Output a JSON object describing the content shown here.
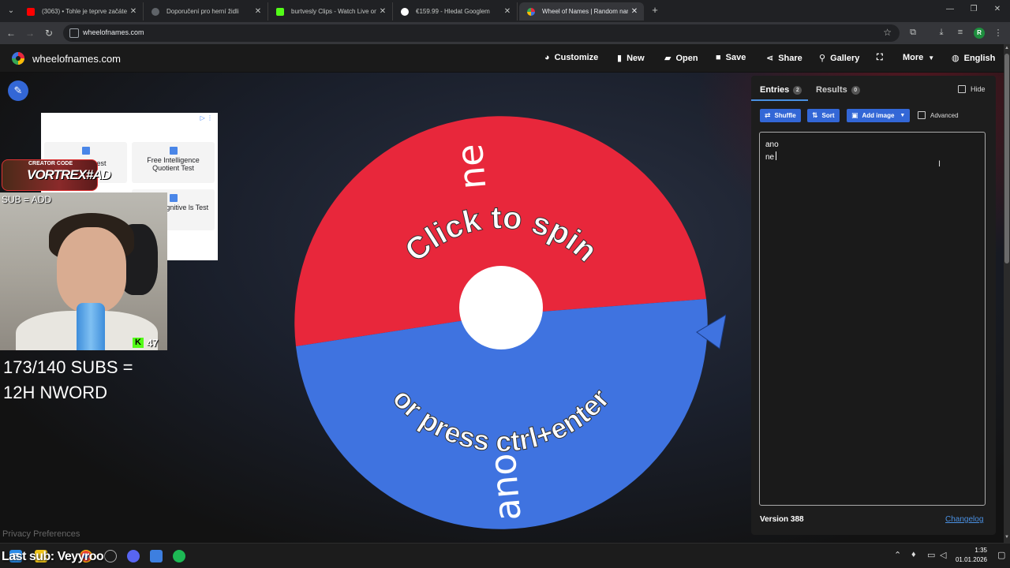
{
  "browser": {
    "tabs": [
      {
        "title": "(3063) • Tohle je teprve začátek",
        "favicon_color": "#ff0000"
      },
      {
        "title": "Doporučení pro herní židli",
        "favicon_color": "#5f6368"
      },
      {
        "title": "burtvesly Clips - Watch Live on",
        "favicon_color": "#53fc18"
      },
      {
        "title": "€159.99 - Hledat Googlem",
        "favicon_color": "#ffffff"
      },
      {
        "title": "Wheel of Names | Random nam",
        "favicon_color": "#4285f4"
      }
    ],
    "url": "wheelofnames.com",
    "profile_initial": "R"
  },
  "app": {
    "site_name": "wheelofnames.com",
    "menu": [
      {
        "label": "Customize",
        "icon": "palette-icon"
      },
      {
        "label": "New",
        "icon": "file-icon"
      },
      {
        "label": "Open",
        "icon": "folder-icon"
      },
      {
        "label": "Save",
        "icon": "save-icon"
      },
      {
        "label": "Share",
        "icon": "share-icon"
      },
      {
        "label": "Gallery",
        "icon": "search-icon"
      },
      {
        "label": "",
        "icon": "fullscreen-icon"
      },
      {
        "label": "More",
        "icon": "chevron-down-icon"
      },
      {
        "label": "English",
        "icon": "globe-icon"
      }
    ]
  },
  "wheel": {
    "segments": [
      {
        "label": "ne",
        "color": "#e8273b"
      },
      {
        "label": "ano",
        "color": "#3f73e0"
      }
    ],
    "instruction_top": "Click to spin",
    "instruction_bottom": "or press ctrl+enter"
  },
  "ad": {
    "cards": [
      "est",
      "Free Intelligence Quotient Test",
      "Cognitive ls Test"
    ]
  },
  "stream": {
    "creator_small": "CREATOR CODE",
    "creator_code": "VORTREX#AD",
    "sub_add": "SUB = ADD",
    "kick_viewers": "47",
    "subs_goal": "173/140 SUBS =\n12H NWORD",
    "last_sub": "Last sub: Veyyroo"
  },
  "privacy": "Privacy Preferences",
  "panel": {
    "tab_entries": "Entries",
    "entries_count": "2",
    "tab_results": "Results",
    "results_count": "0",
    "hide_label": "Hide",
    "shuffle_label": "Shuffle",
    "sort_label": "Sort",
    "add_image_label": "Add image",
    "advanced_label": "Advanced",
    "entries": [
      "ano",
      "ne"
    ],
    "version": "Version 388",
    "changelog": "Changelog"
  },
  "taskbar": {
    "time": "1:35",
    "date": "01.01.2026"
  }
}
